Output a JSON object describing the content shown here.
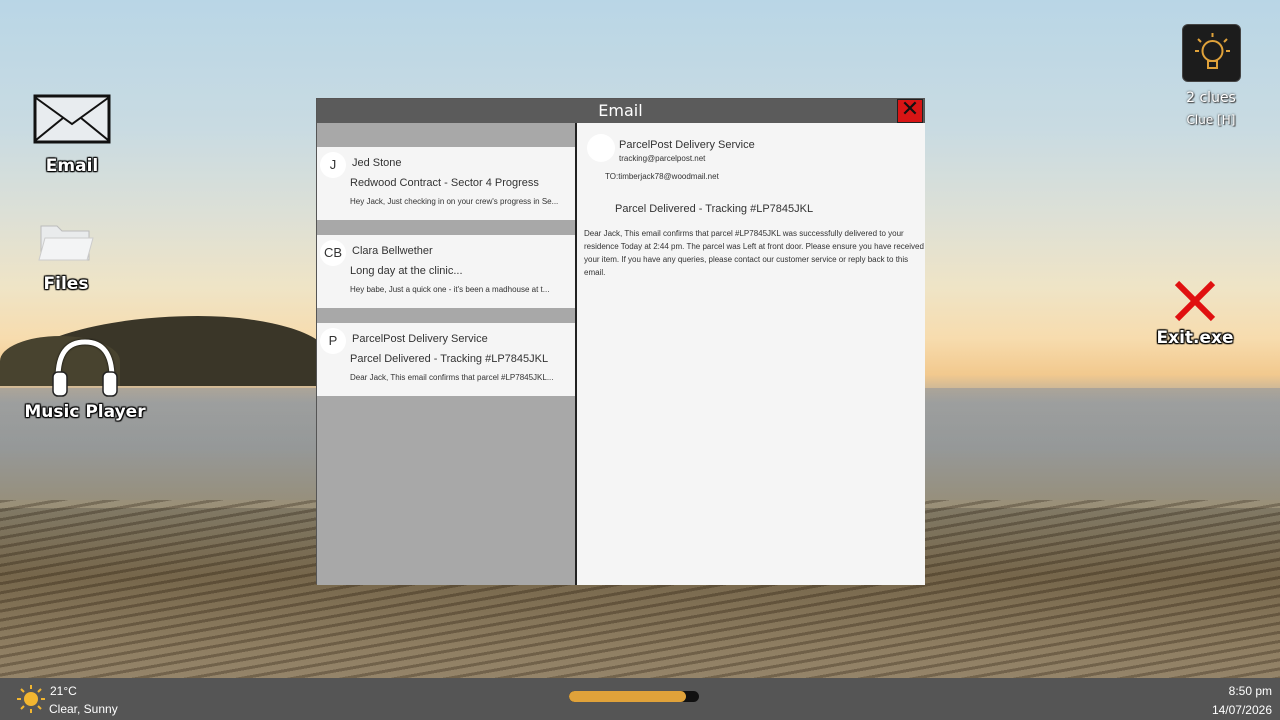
{
  "desktop": {
    "icons": [
      {
        "label": "Email",
        "icon": "envelope-icon"
      },
      {
        "label": "Files",
        "icon": "folder-icon"
      },
      {
        "label": "Music Player",
        "icon": "headphones-icon"
      },
      {
        "label": "Exit.exe",
        "icon": "red-x-icon"
      }
    ]
  },
  "clues": {
    "count_label": "2 clues",
    "hint_label": "Clue [H]",
    "icon": "lightbulb-icon",
    "accent": "#e0a23a"
  },
  "window": {
    "title": "Email",
    "close_glyph": "✕",
    "close_color": "#d81515"
  },
  "inbox": [
    {
      "avatar": "J",
      "sender": "Jed Stone",
      "subject": "Redwood Contract - Sector 4 Progress",
      "preview": "Hey Jack, Just checking in on your crew's progress in Se..."
    },
    {
      "avatar": "CB",
      "sender": "Clara Bellwether",
      "subject": "Long day at the clinic...",
      "preview": "Hey babe, Just a quick one - it's been a madhouse at t..."
    },
    {
      "avatar": "P",
      "sender": "ParcelPost Delivery Service",
      "subject": "Parcel Delivered - Tracking #LP7845JKL",
      "preview": "Dear Jack, This email confirms that parcel #LP7845JKL..."
    }
  ],
  "reading": {
    "from_name": "ParcelPost Delivery Service",
    "from_email": "tracking@parcelpost.net",
    "to": "TO:timberjack78@woodmail.net",
    "subject": "Parcel Delivered - Tracking #LP7845JKL",
    "body": "Dear Jack, This email confirms that parcel #LP7845JKL was successfully delivered to your residence Today at 2:44 pm. The parcel was Left at front door. Please ensure you have received your item. If you have any queries, please contact our customer service or reply back to this email."
  },
  "taskbar": {
    "weather_icon": "sun-icon",
    "temperature": "21°C",
    "condition": "Clear, Sunny",
    "progress_fraction": 0.9,
    "time": "8:50 pm",
    "date": "14/07/2026"
  }
}
